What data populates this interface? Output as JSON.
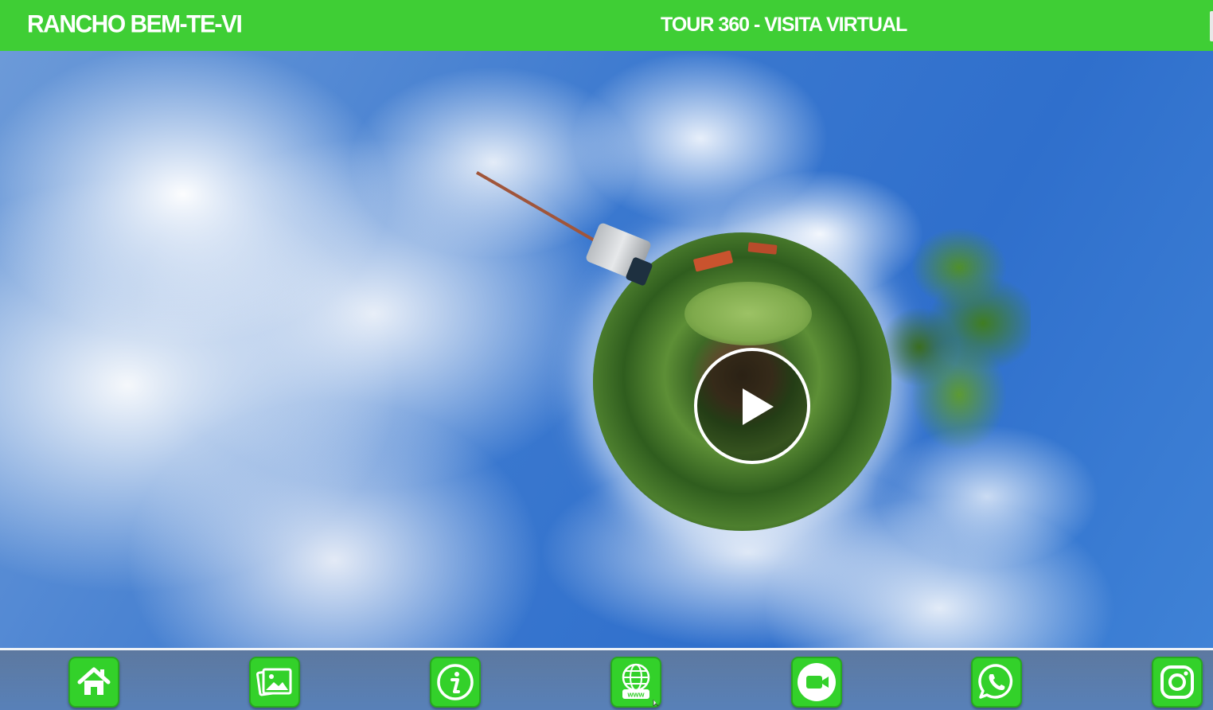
{
  "header": {
    "brand": "RANCHO BEM-TE-VI",
    "title": "TOUR 360 - VISITA VIRTUAL",
    "bar_color": "#3fce35"
  },
  "viewer": {
    "play_icon": "play-icon"
  },
  "toolbar": {
    "button_color": "#33d12a",
    "buttons": [
      {
        "name": "home-button",
        "icon": "home-icon"
      },
      {
        "name": "gallery-button",
        "icon": "photo-gallery-icon"
      },
      {
        "name": "info-button",
        "icon": "info-icon"
      },
      {
        "name": "website-button",
        "icon": "globe-www-icon",
        "label": "www"
      },
      {
        "name": "video-button",
        "icon": "video-camera-icon"
      },
      {
        "name": "whatsapp-button",
        "icon": "whatsapp-icon"
      },
      {
        "name": "instagram-button",
        "icon": "instagram-icon"
      }
    ]
  }
}
